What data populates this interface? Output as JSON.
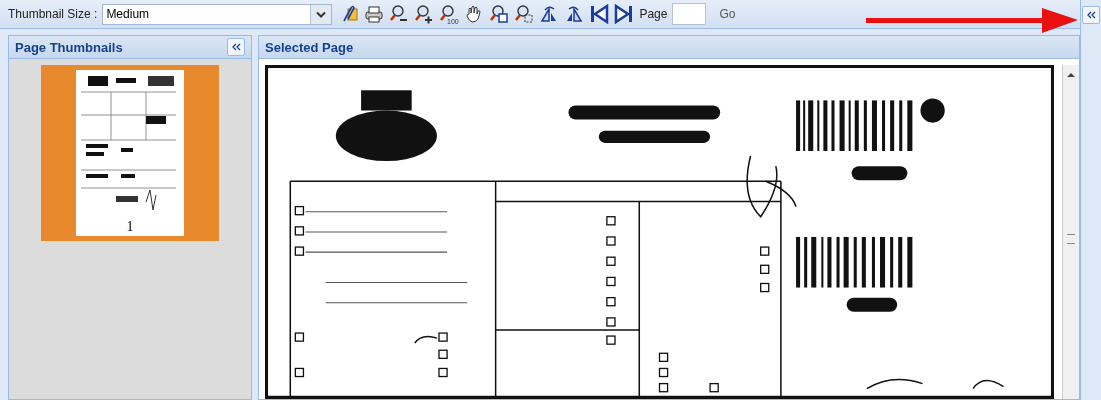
{
  "toolbar": {
    "thumbnail_size_label": "Thumbnail Size :",
    "thumbnail_size": {
      "value": "Medium"
    },
    "tools": [
      {
        "kind": "attach"
      },
      {
        "kind": "print"
      },
      {
        "kind": "zoom-out"
      },
      {
        "kind": "zoom-in"
      },
      {
        "kind": "zoom-100",
        "label": "100"
      },
      {
        "kind": "hand"
      },
      {
        "kind": "zoom-page"
      },
      {
        "kind": "zoom-area"
      },
      {
        "kind": "rotate-left"
      },
      {
        "kind": "rotate-right"
      },
      {
        "kind": "first"
      },
      {
        "kind": "last"
      }
    ],
    "page_label": "Page",
    "go": "Go"
  },
  "thumbnails": {
    "title": "Page Thumbnails",
    "pages": [
      {
        "number": "1",
        "selected": true
      }
    ]
  },
  "selected_page": {
    "title": "Selected Page"
  }
}
